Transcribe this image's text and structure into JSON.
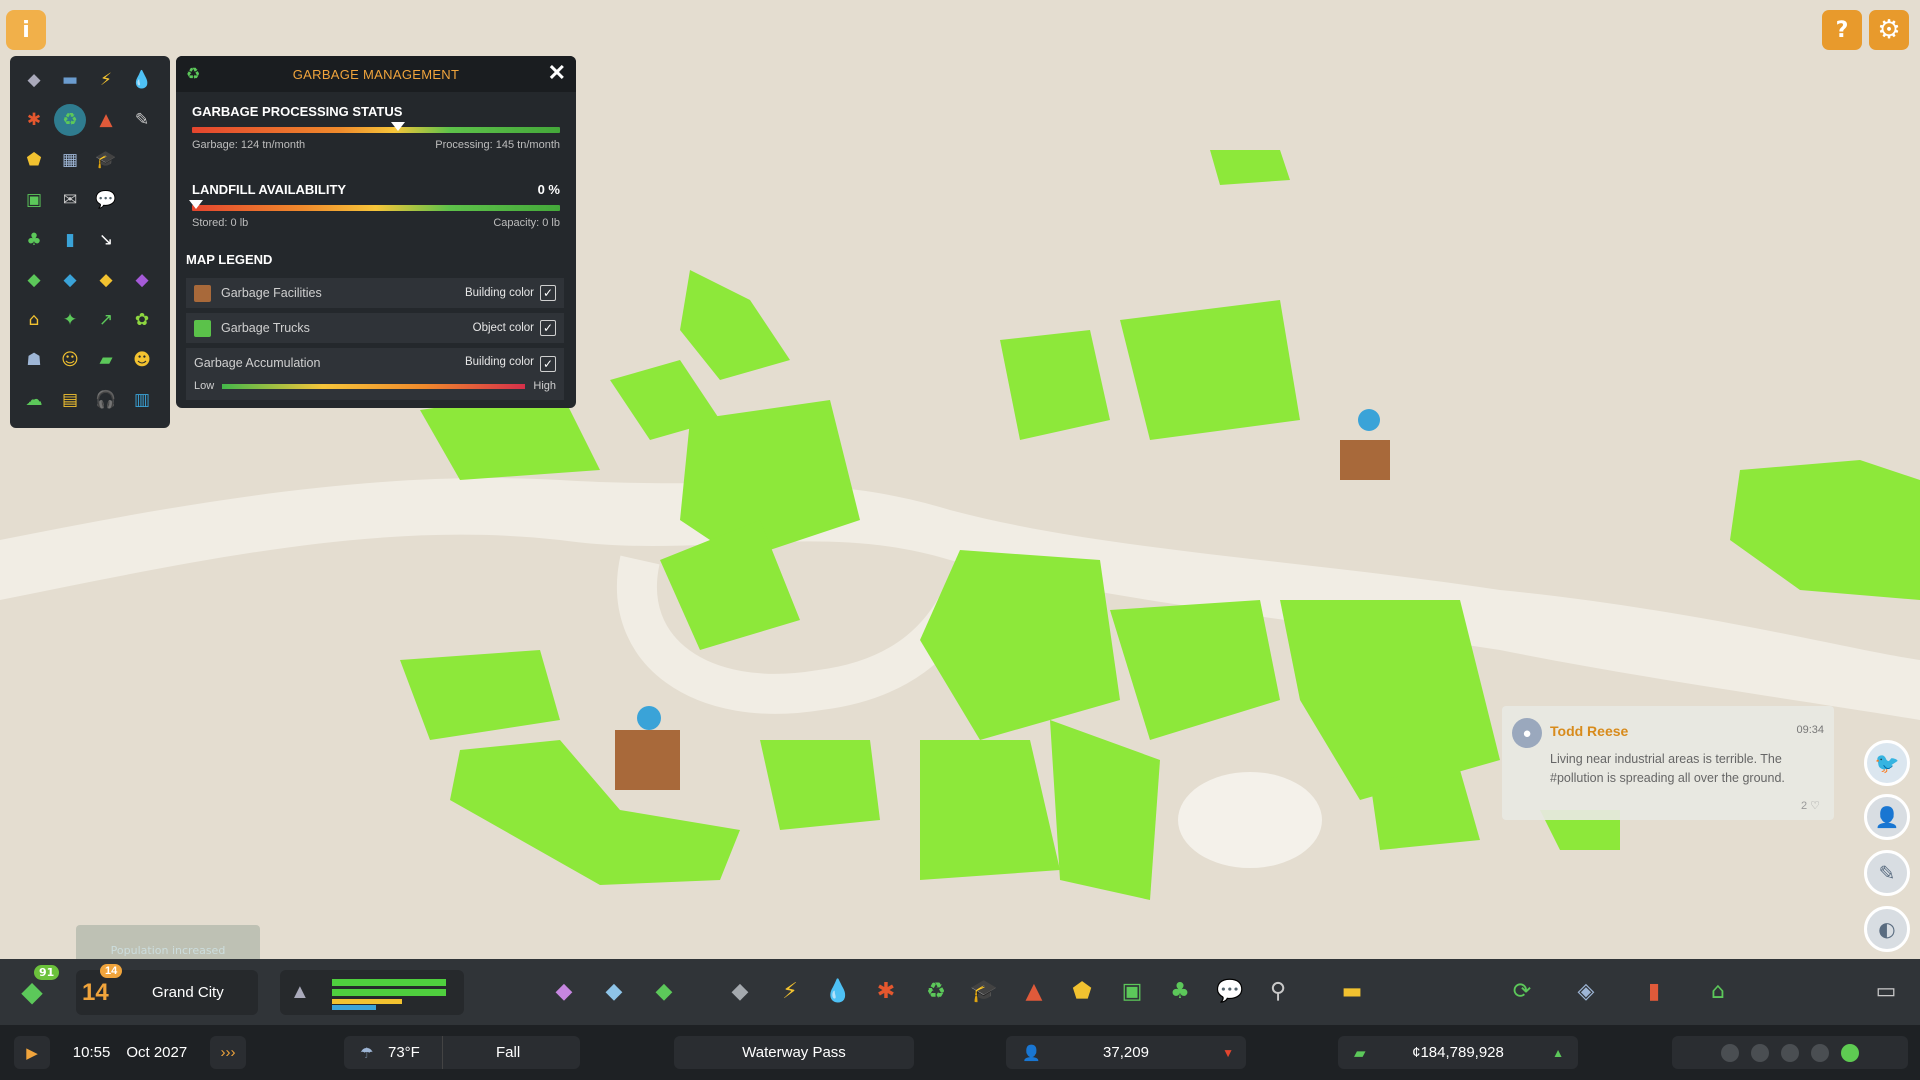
{
  "panel": {
    "title": "GARBAGE MANAGEMENT",
    "processing": {
      "heading": "GARBAGE PROCESSING STATUS",
      "left": "Garbage: 124 tn/month",
      "right": "Processing: 145 tn/month",
      "level": 0.56
    },
    "landfill": {
      "heading": "LANDFILL AVAILABILITY",
      "percent": "0 %",
      "left": "Stored: 0 lb",
      "right": "Capacity: 0 lb",
      "level": 0
    },
    "legend_heading": "MAP LEGEND",
    "legend": [
      {
        "label": "Garbage Facilities",
        "mode": "Building color",
        "color": "#a8693a",
        "checked": true
      },
      {
        "label": "Garbage Trucks",
        "mode": "Object color",
        "color": "#5bc24a",
        "checked": true
      },
      {
        "label": "Garbage Accumulation",
        "mode": "Building color",
        "checked": true
      }
    ],
    "scale_low": "Low",
    "scale_high": "High",
    "close_icon": "close-icon"
  },
  "chat": {
    "name": "Todd Reese",
    "time": "09:34",
    "text": "Living near industrial areas is terrible. The #pollution is spreading all over the ground.",
    "likes": "2"
  },
  "toolbar": {
    "milestone_level": "91",
    "city_level": "14",
    "city_level_small": "14",
    "city_name": "Grand City",
    "notice": "Population increased"
  },
  "status": {
    "time": "10:55",
    "date": "Oct 2027",
    "speed": "›››",
    "temperature": "73°F",
    "season": "Fall",
    "map_name": "Waterway Pass",
    "population": "37,209",
    "money": "¢184,789,928"
  },
  "colors": {
    "accent": "#f0a43c",
    "district_green": "#8de83a",
    "panel_bg": "#24282c"
  }
}
